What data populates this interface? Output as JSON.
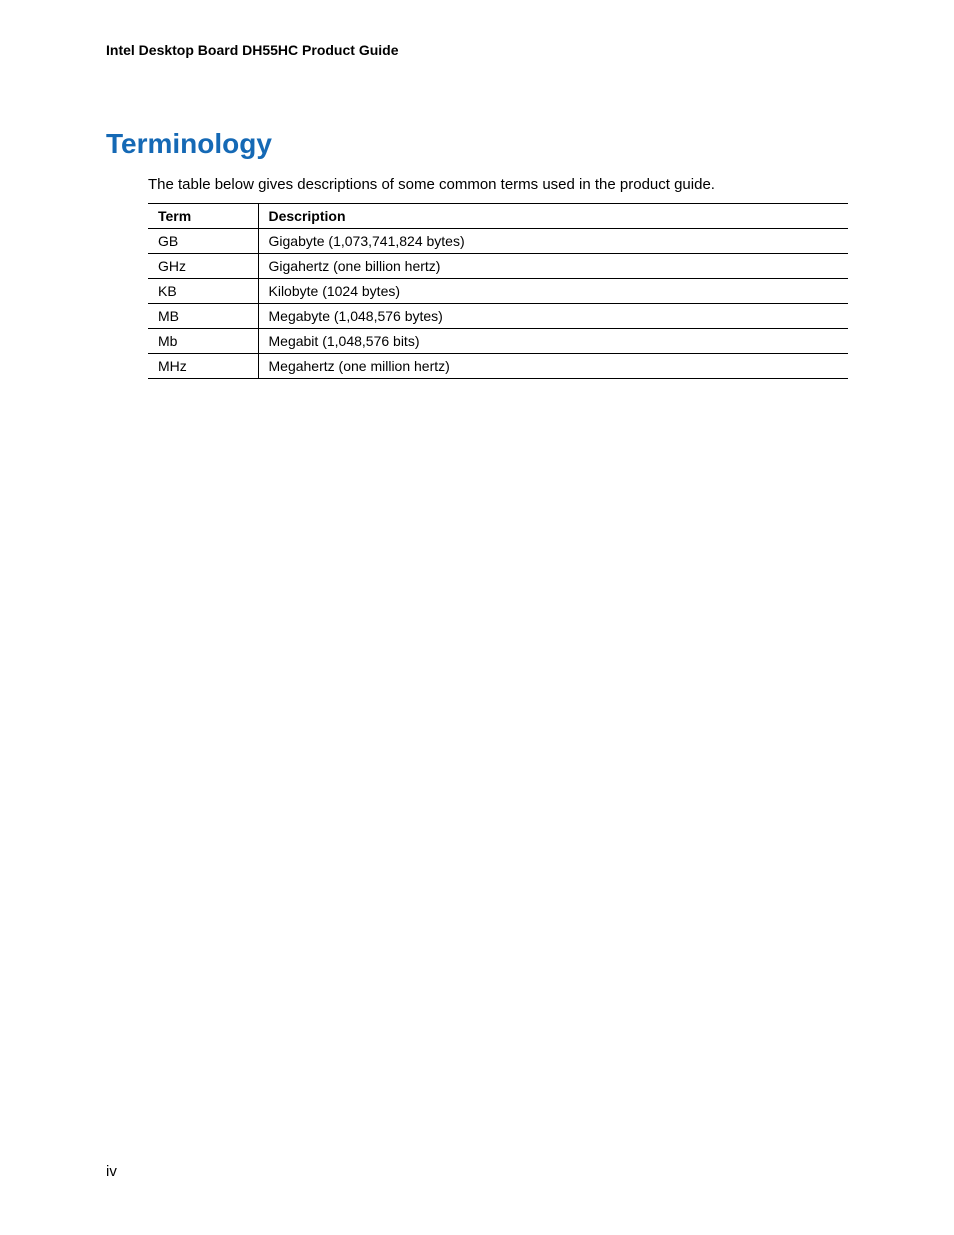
{
  "header": {
    "title": "Intel Desktop Board DH55HC Product Guide"
  },
  "section": {
    "title": "Terminology",
    "intro": "The table below gives descriptions of some common terms used in the product guide."
  },
  "table": {
    "headers": {
      "term": "Term",
      "description": "Description"
    },
    "rows": [
      {
        "term": "GB",
        "description": "Gigabyte (1,073,741,824 bytes)"
      },
      {
        "term": "GHz",
        "description": "Gigahertz (one billion hertz)"
      },
      {
        "term": "KB",
        "description": "Kilobyte (1024 bytes)"
      },
      {
        "term": "MB",
        "description": "Megabyte (1,048,576 bytes)"
      },
      {
        "term": "Mb",
        "description": "Megabit (1,048,576 bits)"
      },
      {
        "term": "MHz",
        "description": "Megahertz (one million hertz)"
      }
    ]
  },
  "page_number": "iv"
}
